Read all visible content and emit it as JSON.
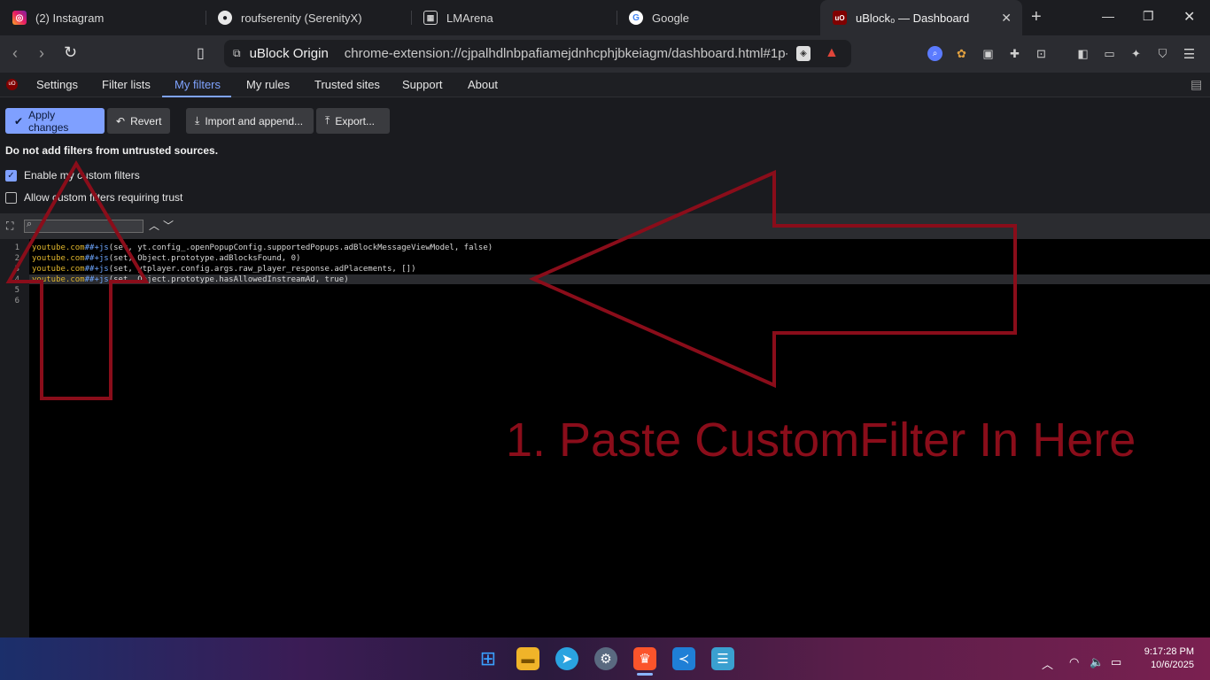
{
  "tabs": [
    {
      "label": "(2) Instagram",
      "icon": "instagram-icon"
    },
    {
      "label": "roufserenity (SerenityX)",
      "icon": "github-icon"
    },
    {
      "label": "LMArena",
      "icon": "grid-icon"
    },
    {
      "label": "Google",
      "icon": "google-icon"
    },
    {
      "label": "uBlock₀ — Dashboard",
      "icon": "ublock-icon"
    }
  ],
  "address": {
    "site": "uBlock Origin",
    "url": "chrome-extension://cjpalhdlnbpafiamejdnhcphjbkeiagm/dashboard.html#1p-..."
  },
  "nav": {
    "items": [
      "Settings",
      "Filter lists",
      "My filters",
      "My rules",
      "Trusted sites",
      "Support",
      "About"
    ],
    "selected": "My filters"
  },
  "actions": {
    "apply": "Apply changes",
    "revert": "Revert",
    "import": "Import and append...",
    "export": "Export..."
  },
  "warning": "Do not add filters from untrusted sources.",
  "options": {
    "enable": {
      "label": "Enable my custom filters",
      "checked": true
    },
    "trust": {
      "label": "Allow custom filters requiring trust",
      "checked": false
    }
  },
  "editor": {
    "line_numbers": [
      "1",
      "2",
      "3",
      "4",
      "5",
      "6"
    ],
    "lines": [
      {
        "domain": "youtube.com",
        "op": "##+js",
        "rest": "(set, yt.config_.openPopupConfig.supportedPopups.adBlockMessageViewModel, false)"
      },
      {
        "domain": "youtube.com",
        "op": "##+js",
        "rest": "(set, Object.prototype.adBlocksFound, 0)"
      },
      {
        "domain": "youtube.com",
        "op": "##+js",
        "rest": "(set, ytplayer.config.args.raw_player_response.adPlacements, [])"
      },
      {
        "domain": "youtube.com",
        "op": "##+js",
        "rest": "(set, Object.prototype.hasAllowedInstreamAd, true)"
      }
    ]
  },
  "annotation": "1. Paste CustomFilter In Here",
  "clock": {
    "time": "9:17:28 PM",
    "date": "10/6/2025"
  },
  "colors": {
    "accent": "#7fa3ff",
    "annotation": "#8a0d1a",
    "editor_bg": "#000000"
  }
}
